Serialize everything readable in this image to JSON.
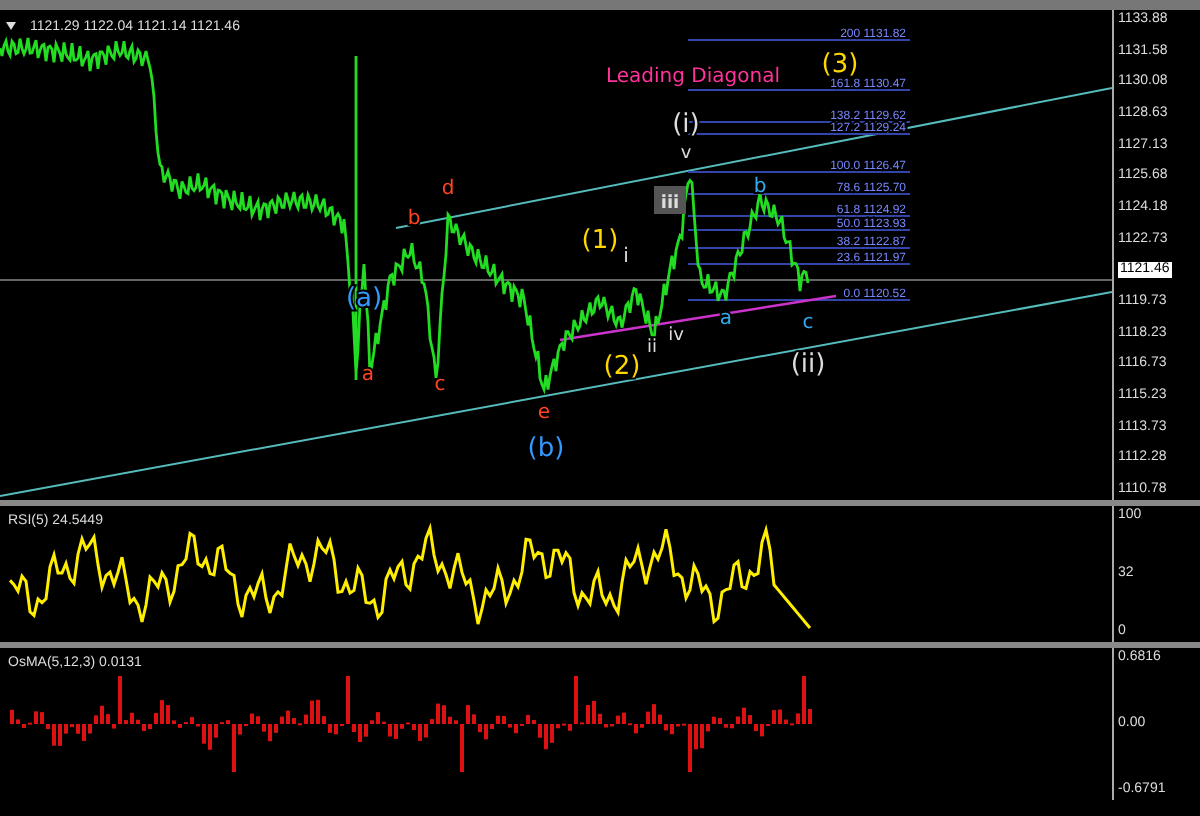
{
  "main_chart": {
    "header": "1121.29 1122.04 1121.14 1121.46",
    "annotation": "Leading Diagonal",
    "axis_ticks": [
      {
        "label": "1133.88",
        "kind": "tick"
      },
      {
        "label": "1131.58",
        "kind": "tick"
      },
      {
        "label": "1130.08",
        "kind": "tick"
      },
      {
        "label": "1128.63",
        "kind": "tick"
      },
      {
        "label": "1127.13",
        "kind": "tick"
      },
      {
        "label": "1125.68",
        "kind": "tick"
      },
      {
        "label": "1124.18",
        "kind": "tick"
      },
      {
        "label": "1122.73",
        "kind": "tick"
      },
      {
        "label": "1121.46",
        "kind": "current"
      },
      {
        "label": "1119.73",
        "kind": "tick"
      },
      {
        "label": "1118.23",
        "kind": "tick"
      },
      {
        "label": "1116.73",
        "kind": "tick"
      },
      {
        "label": "1115.23",
        "kind": "tick"
      },
      {
        "label": "1113.73",
        "kind": "tick"
      },
      {
        "label": "1112.28",
        "kind": "tick"
      },
      {
        "label": "1110.78",
        "kind": "tick"
      }
    ],
    "fib_levels": [
      {
        "label": "200 1131.82"
      },
      {
        "label": "161.8 1130.47"
      },
      {
        "label": "138.2 1129.62"
      },
      {
        "label": "127.2 1129.24"
      },
      {
        "label": "100.0 1126.47"
      },
      {
        "label": "78.6 1125.70"
      },
      {
        "label": "61.8 1124.92"
      },
      {
        "label": "50.0 1123.93"
      },
      {
        "label": "38.2 1122.87"
      },
      {
        "label": "23.6 1121.97"
      },
      {
        "label": "0.0 1120.52"
      }
    ],
    "wave_labels": [
      {
        "text": "(3)",
        "color": "#ffd700",
        "kind": "plain"
      },
      {
        "text": "(i)",
        "color": "#dddddd",
        "kind": "plain"
      },
      {
        "text": "v",
        "color": "#dddddd",
        "kind": "plain"
      },
      {
        "text": "b",
        "color": "#33aaee",
        "kind": "plain"
      },
      {
        "text": "d",
        "color": "#ff4422",
        "kind": "plain"
      },
      {
        "text": "iii",
        "color": "#dddddd",
        "kind": "boxed"
      },
      {
        "text": "b",
        "color": "#ff4422",
        "kind": "plain"
      },
      {
        "text": "(1)",
        "color": "#ffd700",
        "kind": "plain"
      },
      {
        "text": "i",
        "color": "#dddddd",
        "kind": "plain"
      },
      {
        "text": "(a)",
        "color": "#3399ff",
        "kind": "plain"
      },
      {
        "text": "a",
        "color": "#33aaee",
        "kind": "plain"
      },
      {
        "text": "c",
        "color": "#33aaee",
        "kind": "plain"
      },
      {
        "text": "iv",
        "color": "#dddddd",
        "kind": "plain"
      },
      {
        "text": "ii",
        "color": "#dddddd",
        "kind": "plain"
      },
      {
        "text": "a",
        "color": "#ff4422",
        "kind": "plain"
      },
      {
        "text": "c",
        "color": "#ff4422",
        "kind": "plain"
      },
      {
        "text": "(2)",
        "color": "#ffd700",
        "kind": "plain"
      },
      {
        "text": "(ii)",
        "color": "#dddddd",
        "kind": "plain"
      },
      {
        "text": "e",
        "color": "#ff4422",
        "kind": "plain"
      },
      {
        "text": "(b)",
        "color": "#3399ff",
        "kind": "plain"
      }
    ]
  },
  "rsi_panel": {
    "header": "RSI(5) 24.5449",
    "axis_ticks": [
      "100",
      "32",
      "0"
    ]
  },
  "osma_panel": {
    "header": "OsMA(5,12,3) 0.0131",
    "axis_ticks": [
      "0.6816",
      "0.00",
      "-0.6791"
    ]
  }
}
